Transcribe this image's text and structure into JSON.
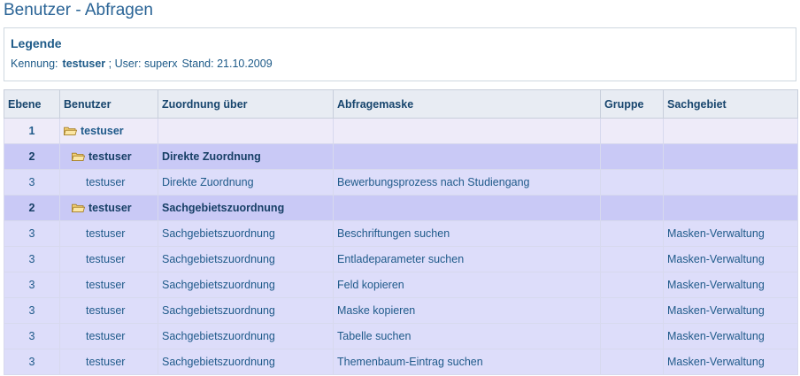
{
  "page": {
    "title": "Benutzer - Abfragen"
  },
  "legend": {
    "title": "Legende",
    "kennung_label": "Kennung:",
    "kennung_value": "testuser",
    "user_text": "; User: superx",
    "stand_text": "Stand: 21.10.2009"
  },
  "table": {
    "headers": [
      "Ebene",
      "Benutzer",
      "Zuordnung über",
      "Abfragemaske",
      "Gruppe",
      "Sachgebiet"
    ],
    "rows": [
      {
        "ebene": "1",
        "benutzer": "testuser",
        "zuordnung": "",
        "maske": "",
        "gruppe": "",
        "sachgebiet": ""
      },
      {
        "ebene": "2",
        "benutzer": "testuser",
        "zuordnung": "Direkte Zuordnung",
        "maske": "",
        "gruppe": "",
        "sachgebiet": ""
      },
      {
        "ebene": "3",
        "benutzer": "testuser",
        "zuordnung": "Direkte Zuordnung",
        "maske": "Bewerbungsprozess nach Studiengang",
        "gruppe": "",
        "sachgebiet": ""
      },
      {
        "ebene": "2",
        "benutzer": "testuser",
        "zuordnung": "Sachgebietszuordnung",
        "maske": "",
        "gruppe": "",
        "sachgebiet": ""
      },
      {
        "ebene": "3",
        "benutzer": "testuser",
        "zuordnung": "Sachgebietszuordnung",
        "maske": "Beschriftungen suchen",
        "gruppe": "",
        "sachgebiet": "Masken-Verwaltung"
      },
      {
        "ebene": "3",
        "benutzer": "testuser",
        "zuordnung": "Sachgebietszuordnung",
        "maske": "Entladeparameter suchen",
        "gruppe": "",
        "sachgebiet": "Masken-Verwaltung"
      },
      {
        "ebene": "3",
        "benutzer": "testuser",
        "zuordnung": "Sachgebietszuordnung",
        "maske": "Feld kopieren",
        "gruppe": "",
        "sachgebiet": "Masken-Verwaltung"
      },
      {
        "ebene": "3",
        "benutzer": "testuser",
        "zuordnung": "Sachgebietszuordnung",
        "maske": "Maske kopieren",
        "gruppe": "",
        "sachgebiet": "Masken-Verwaltung"
      },
      {
        "ebene": "3",
        "benutzer": "testuser",
        "zuordnung": "Sachgebietszuordnung",
        "maske": "Tabelle suchen",
        "gruppe": "",
        "sachgebiet": "Masken-Verwaltung"
      },
      {
        "ebene": "3",
        "benutzer": "testuser",
        "zuordnung": "Sachgebietszuordnung",
        "maske": "Themenbaum-Eintrag suchen",
        "gruppe": "",
        "sachgebiet": "Masken-Verwaltung"
      }
    ]
  },
  "icons": {
    "folder": "folder-open-icon"
  },
  "colors": {
    "title": "#2a6496",
    "header_bg": "#e8ecf3",
    "level1_bg": "#eeebf9",
    "level2_bg": "#c9c9f6",
    "level3_bg": "#ddddfa"
  }
}
